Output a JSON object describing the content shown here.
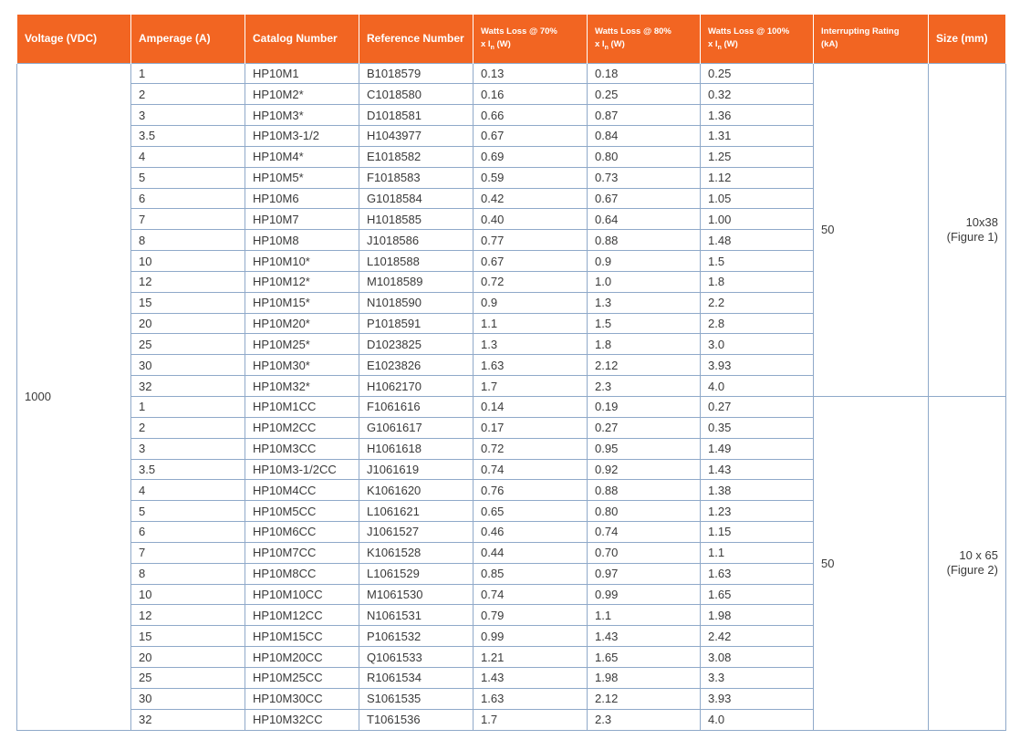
{
  "headers": {
    "voltage": "Voltage (VDC)",
    "amperage": "Amperage (A)",
    "catalog": "Catalog Number",
    "reference": "Reference Number",
    "w70_line1": "Watts Loss @ 70%",
    "w70_line2": "x I",
    "w70_sub": "n",
    "w70_unit": " (W)",
    "w80_line1": "Watts Loss @ 80%",
    "w80_line2": "x I",
    "w80_sub": "n",
    "w80_unit": " (W)",
    "w100_line1": "Watts Loss @ 100%",
    "w100_line2": "x I",
    "w100_sub": "n",
    "w100_unit": " (W)",
    "rating_line1": "Interrupting Rating",
    "rating_line2": "(kA)",
    "size": "Size (mm)"
  },
  "voltage": "1000",
  "groups": [
    {
      "rating": "50",
      "size_line1": "10x38",
      "size_line2": "(Figure 1)",
      "rows": [
        [
          "1",
          "HP10M1",
          "B1018579",
          "0.13",
          "0.18",
          "0.25"
        ],
        [
          "2",
          "HP10M2*",
          "C1018580",
          "0.16",
          "0.25",
          "0.32"
        ],
        [
          "3",
          "HP10M3*",
          "D1018581",
          "0.66",
          "0.87",
          "1.36"
        ],
        [
          "3.5",
          "HP10M3-1/2",
          "H1043977",
          "0.67",
          "0.84",
          "1.31"
        ],
        [
          "4",
          "HP10M4*",
          "E1018582",
          "0.69",
          "0.80",
          "1.25"
        ],
        [
          "5",
          "HP10M5*",
          "F1018583",
          "0.59",
          "0.73",
          "1.12"
        ],
        [
          "6",
          "HP10M6",
          "G1018584",
          "0.42",
          "0.67",
          "1.05"
        ],
        [
          "7",
          "HP10M7",
          "H1018585",
          "0.40",
          "0.64",
          "1.00"
        ],
        [
          "8",
          "HP10M8",
          "J1018586",
          "0.77",
          "0.88",
          "1.48"
        ],
        [
          "10",
          "HP10M10*",
          "L1018588",
          "0.67",
          "0.9",
          "1.5"
        ],
        [
          "12",
          "HP10M12*",
          "M1018589",
          "0.72",
          "1.0",
          "1.8"
        ],
        [
          "15",
          "HP10M15*",
          "N1018590",
          "0.9",
          "1.3",
          "2.2"
        ],
        [
          "20",
          "HP10M20*",
          "P1018591",
          "1.1",
          "1.5",
          "2.8"
        ],
        [
          "25",
          "HP10M25*",
          "D1023825",
          "1.3",
          "1.8",
          "3.0"
        ],
        [
          "30",
          "HP10M30*",
          "E1023826",
          "1.63",
          "2.12",
          "3.93"
        ],
        [
          "32",
          "HP10M32*",
          "H1062170",
          "1.7",
          "2.3",
          "4.0"
        ]
      ]
    },
    {
      "rating": "50",
      "size_line1": "10 x 65",
      "size_line2": "(Figure 2)",
      "rows": [
        [
          "1",
          "HP10M1CC",
          "F1061616",
          "0.14",
          "0.19",
          "0.27"
        ],
        [
          "2",
          "HP10M2CC",
          "G1061617",
          "0.17",
          "0.27",
          "0.35"
        ],
        [
          "3",
          "HP10M3CC",
          "H1061618",
          "0.72",
          "0.95",
          "1.49"
        ],
        [
          "3.5",
          "HP10M3-1/2CC",
          "J1061619",
          "0.74",
          "0.92",
          "1.43"
        ],
        [
          "4",
          "HP10M4CC",
          "K1061620",
          "0.76",
          "0.88",
          "1.38"
        ],
        [
          "5",
          "HP10M5CC",
          "L1061621",
          "0.65",
          "0.80",
          "1.23"
        ],
        [
          "6",
          "HP10M6CC",
          "J1061527",
          "0.46",
          "0.74",
          "1.15"
        ],
        [
          "7",
          "HP10M7CC",
          "K1061528",
          "0.44",
          "0.70",
          "1.1"
        ],
        [
          "8",
          "HP10M8CC",
          "L1061529",
          "0.85",
          "0.97",
          "1.63"
        ],
        [
          "10",
          "HP10M10CC",
          "M1061530",
          "0.74",
          "0.99",
          "1.65"
        ],
        [
          "12",
          "HP10M12CC",
          "N1061531",
          "0.79",
          "1.1",
          "1.98"
        ],
        [
          "15",
          "HP10M15CC",
          "P1061532",
          "0.99",
          "1.43",
          "2.42"
        ],
        [
          "20",
          "HP10M20CC",
          "Q1061533",
          "1.21",
          "1.65",
          "3.08"
        ],
        [
          "25",
          "HP10M25CC",
          "R1061534",
          "1.43",
          "1.98",
          "3.3"
        ],
        [
          "30",
          "HP10M30CC",
          "S1061535",
          "1.63",
          "2.12",
          "3.93"
        ],
        [
          "32",
          "HP10M32CC",
          "T1061536",
          "1.7",
          "2.3",
          "4.0"
        ]
      ]
    }
  ],
  "colors": {
    "header_bg": "#f26522",
    "header_text": "#ffffff",
    "grid_line": "#8fa9c9",
    "body_text": "#3a3a3a"
  }
}
